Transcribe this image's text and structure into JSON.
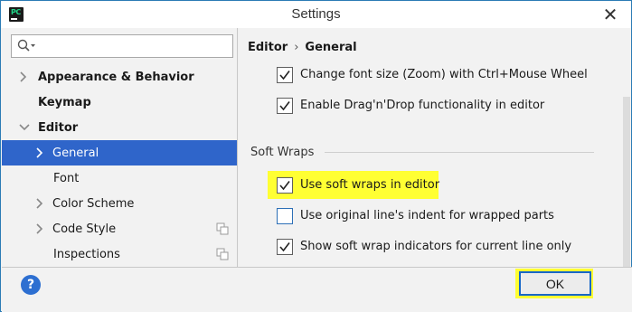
{
  "window": {
    "title": "Settings",
    "close_glyph": "✕",
    "app_icon_text": "PC"
  },
  "search": {
    "placeholder": "",
    "value": ""
  },
  "tree": {
    "items": [
      {
        "label": "Appearance & Behavior",
        "bold": true,
        "expandable": true,
        "expanded": false
      },
      {
        "label": "Keymap",
        "bold": true,
        "expandable": false
      },
      {
        "label": "Editor",
        "bold": true,
        "expandable": true,
        "expanded": true
      },
      {
        "label": "General",
        "bold": false,
        "expandable": true,
        "expanded": false,
        "selected": true
      },
      {
        "label": "Font",
        "bold": false,
        "expandable": false
      },
      {
        "label": "Color Scheme",
        "bold": false,
        "expandable": true,
        "expanded": false
      },
      {
        "label": "Code Style",
        "bold": false,
        "expandable": true,
        "expanded": false,
        "copy_icon": true
      },
      {
        "label": "Inspections",
        "bold": false,
        "expandable": false,
        "copy_icon": true
      }
    ]
  },
  "breadcrumb": {
    "parent": "Editor",
    "separator": "›",
    "current": "General"
  },
  "options": {
    "change_font_size": {
      "label": "Change font size (Zoom) with Ctrl+Mouse Wheel",
      "checked": true
    },
    "drag_drop": {
      "label": "Enable Drag'n'Drop functionality in editor",
      "checked": true
    }
  },
  "soft_wraps": {
    "title": "Soft Wraps",
    "use_soft_wraps": {
      "label": "Use soft wraps in editor",
      "checked": true
    },
    "original_indent": {
      "label": "Use original line's indent for wrapped parts",
      "checked": false
    },
    "show_indicators": {
      "label": "Show soft wrap indicators for current line only",
      "checked": true
    }
  },
  "footer": {
    "help_label": "?",
    "ok_label": "OK"
  },
  "colors": {
    "selection": "#2f65ca",
    "highlight": "#ffff33",
    "focus_border": "#1767c8"
  }
}
